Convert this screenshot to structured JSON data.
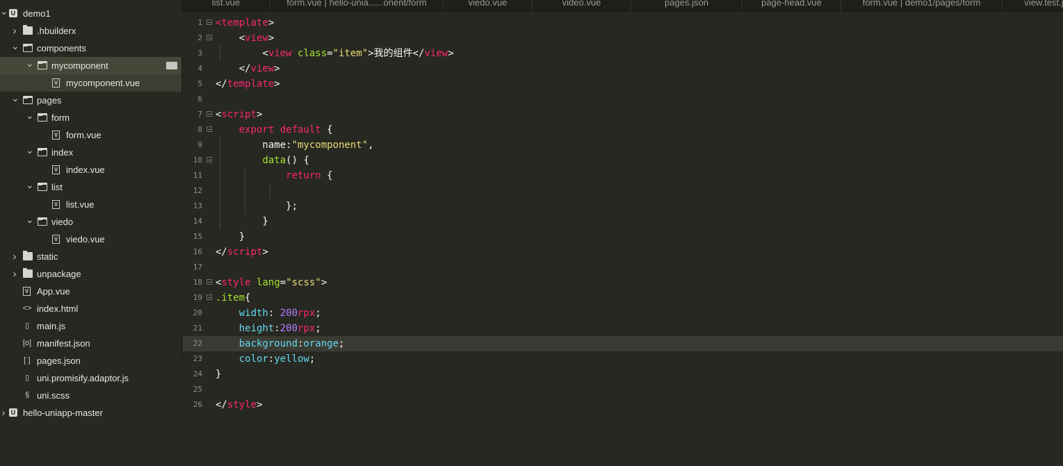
{
  "sidebar": {
    "items": [
      {
        "label": "demo1",
        "icon": "project-icon",
        "expanded": true
      },
      {
        "label": ".hbuilderx",
        "icon": "folder-icon",
        "expanded": false
      },
      {
        "label": "components",
        "icon": "folder-open-icon",
        "expanded": true
      },
      {
        "label": "mycomponent",
        "icon": "folder-open-icon",
        "expanded": true
      },
      {
        "label": "mycomponent.vue",
        "icon": "vue-file-icon"
      },
      {
        "label": "pages",
        "icon": "folder-open-icon",
        "expanded": true
      },
      {
        "label": "form",
        "icon": "folder-open-icon",
        "expanded": true
      },
      {
        "label": "form.vue",
        "icon": "vue-file-icon"
      },
      {
        "label": "index",
        "icon": "folder-open-icon",
        "expanded": true
      },
      {
        "label": "index.vue",
        "icon": "vue-file-icon"
      },
      {
        "label": "list",
        "icon": "folder-open-icon",
        "expanded": true
      },
      {
        "label": "list.vue",
        "icon": "vue-file-icon"
      },
      {
        "label": "viedo",
        "icon": "folder-open-icon",
        "expanded": true
      },
      {
        "label": "viedo.vue",
        "icon": "vue-file-icon"
      },
      {
        "label": "static",
        "icon": "folder-icon",
        "expanded": false
      },
      {
        "label": "unpackage",
        "icon": "folder-icon",
        "expanded": false
      },
      {
        "label": "App.vue",
        "icon": "vue-file-icon"
      },
      {
        "label": "index.html",
        "icon": "html-file-icon"
      },
      {
        "label": "main.js",
        "icon": "js-file-icon"
      },
      {
        "label": "manifest.json",
        "icon": "manifest-file-icon"
      },
      {
        "label": "pages.json",
        "icon": "json-file-icon"
      },
      {
        "label": "uni.promisify.adaptor.js",
        "icon": "js-file-icon"
      },
      {
        "label": "uni.scss",
        "icon": "scss-file-icon"
      },
      {
        "label": "hello-uniapp-master",
        "icon": "project-icon",
        "expanded": false
      }
    ]
  },
  "tabs": [
    {
      "label": "list.vue"
    },
    {
      "label": "form.vue | hello-unia......onent/form"
    },
    {
      "label": "viedo.vue"
    },
    {
      "label": "video.vue"
    },
    {
      "label": "pages.json"
    },
    {
      "label": "page-head.vue"
    },
    {
      "label": "form.vue | demo1/pages/form"
    },
    {
      "label": "view.test.j"
    }
  ],
  "editor": {
    "highlighted_line": 22,
    "lines": [
      [
        {
          "t": "tag",
          "v": "<"
        },
        {
          "t": "tag",
          "v": "template"
        },
        {
          "t": "plain",
          "v": ">"
        }
      ],
      [
        {
          "t": "plain",
          "v": "    <"
        },
        {
          "t": "tag",
          "v": "view"
        },
        {
          "t": "plain",
          "v": ">"
        }
      ],
      [
        {
          "t": "plain",
          "v": "        <"
        },
        {
          "t": "tag",
          "v": "view"
        },
        {
          "t": "plain",
          "v": " "
        },
        {
          "t": "attr",
          "v": "class"
        },
        {
          "t": "plain",
          "v": "="
        },
        {
          "t": "str",
          "v": "\"item\""
        },
        {
          "t": "plain",
          "v": ">我的组件</"
        },
        {
          "t": "tag",
          "v": "view"
        },
        {
          "t": "plain",
          "v": ">"
        }
      ],
      [
        {
          "t": "plain",
          "v": "    </"
        },
        {
          "t": "tag",
          "v": "view"
        },
        {
          "t": "plain",
          "v": ">"
        }
      ],
      [
        {
          "t": "plain",
          "v": "</"
        },
        {
          "t": "tag",
          "v": "template"
        },
        {
          "t": "plain",
          "v": ">"
        }
      ],
      [],
      [
        {
          "t": "plain",
          "v": "<"
        },
        {
          "t": "tag",
          "v": "script"
        },
        {
          "t": "plain",
          "v": ">"
        }
      ],
      [
        {
          "t": "plain",
          "v": "    "
        },
        {
          "t": "kw",
          "v": "export"
        },
        {
          "t": "plain",
          "v": " "
        },
        {
          "t": "kw",
          "v": "default"
        },
        {
          "t": "plain",
          "v": " {"
        }
      ],
      [
        {
          "t": "plain",
          "v": "        name:"
        },
        {
          "t": "str",
          "v": "\"mycomponent\""
        },
        {
          "t": "plain",
          "v": ","
        }
      ],
      [
        {
          "t": "plain",
          "v": "        "
        },
        {
          "t": "fn",
          "v": "data"
        },
        {
          "t": "plain",
          "v": "() {"
        }
      ],
      [
        {
          "t": "plain",
          "v": "            "
        },
        {
          "t": "kw",
          "v": "return"
        },
        {
          "t": "plain",
          "v": " {"
        }
      ],
      [],
      [
        {
          "t": "plain",
          "v": "            };"
        }
      ],
      [
        {
          "t": "plain",
          "v": "        }"
        }
      ],
      [
        {
          "t": "plain",
          "v": "    }"
        }
      ],
      [
        {
          "t": "plain",
          "v": "</"
        },
        {
          "t": "tag",
          "v": "script"
        },
        {
          "t": "plain",
          "v": ">"
        }
      ],
      [],
      [
        {
          "t": "plain",
          "v": "<"
        },
        {
          "t": "tag",
          "v": "style"
        },
        {
          "t": "plain",
          "v": " "
        },
        {
          "t": "attr",
          "v": "lang"
        },
        {
          "t": "plain",
          "v": "="
        },
        {
          "t": "str",
          "v": "\"scss\""
        },
        {
          "t": "plain",
          "v": ">"
        }
      ],
      [
        {
          "t": "sel",
          "v": ".item"
        },
        {
          "t": "plain",
          "v": "{"
        }
      ],
      [
        {
          "t": "plain",
          "v": "    "
        },
        {
          "t": "prop",
          "v": "width"
        },
        {
          "t": "plain",
          "v": ": "
        },
        {
          "t": "num",
          "v": "200"
        },
        {
          "t": "unit",
          "v": "rpx"
        },
        {
          "t": "plain",
          "v": ";"
        }
      ],
      [
        {
          "t": "plain",
          "v": "    "
        },
        {
          "t": "prop",
          "v": "height"
        },
        {
          "t": "plain",
          "v": ":"
        },
        {
          "t": "num",
          "v": "200"
        },
        {
          "t": "unit",
          "v": "rpx"
        },
        {
          "t": "plain",
          "v": ";"
        }
      ],
      [
        {
          "t": "plain",
          "v": "    "
        },
        {
          "t": "prop",
          "v": "background"
        },
        {
          "t": "plain",
          "v": ":"
        },
        {
          "t": "val",
          "v": "orange"
        },
        {
          "t": "plain",
          "v": ";"
        }
      ],
      [
        {
          "t": "plain",
          "v": "    "
        },
        {
          "t": "prop",
          "v": "color"
        },
        {
          "t": "plain",
          "v": ":"
        },
        {
          "t": "val",
          "v": "yellow"
        },
        {
          "t": "plain",
          "v": ";"
        }
      ],
      [
        {
          "t": "plain",
          "v": "}"
        }
      ],
      [],
      [
        {
          "t": "plain",
          "v": "</"
        },
        {
          "t": "tag",
          "v": "style"
        },
        {
          "t": "plain",
          "v": ">"
        }
      ]
    ]
  },
  "colors": {
    "background": "#272822",
    "tag": "#f92672",
    "attribute": "#a6e22e",
    "string": "#e6db74",
    "property": "#66d9ef",
    "number": "#ae81ff"
  }
}
